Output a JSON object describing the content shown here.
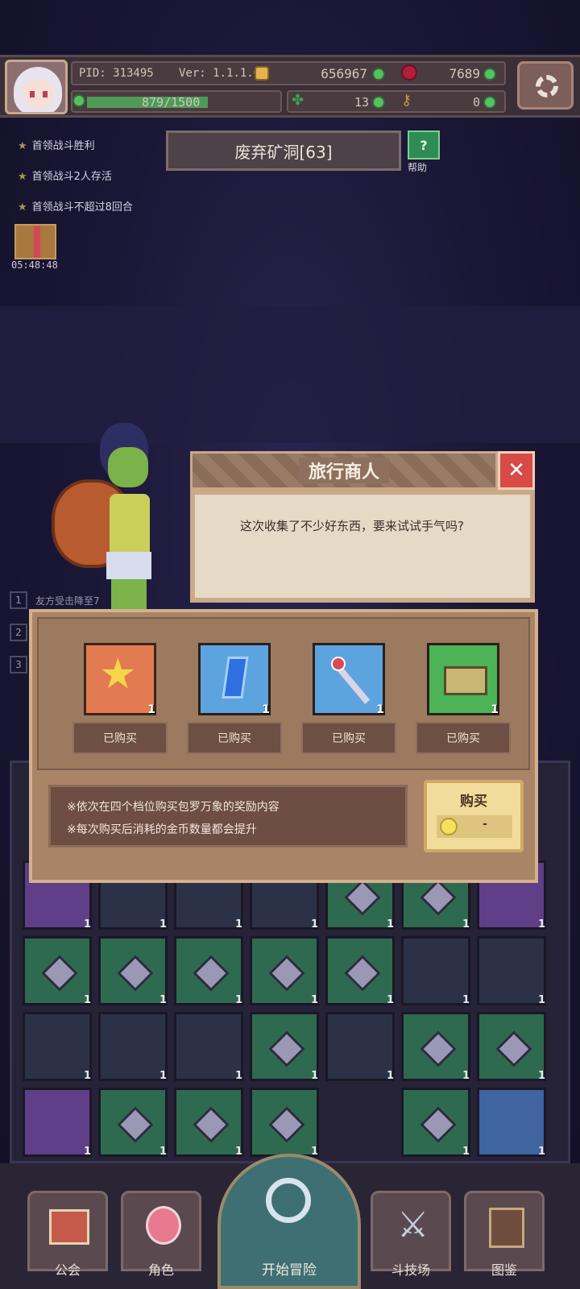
{
  "header": {
    "pid": "PID: 313495",
    "version": "Ver: 1.1.1.0",
    "gold": "656967",
    "red_gems": "7689",
    "exp": "879/1500",
    "clover": "13",
    "keys": "0"
  },
  "quests": [
    "首领战斗胜利",
    "首领战斗2人存活",
    "首领战斗不超过8回合"
  ],
  "timer": "05:48:48",
  "stage": {
    "title": "废弃矿洞[63]",
    "help_label": "帮助"
  },
  "battle_log": [
    "友方受击降至7",
    "",
    ""
  ],
  "dialog": {
    "title": "旅行商人",
    "text": "这次收集了不少好东西，要来试试手气吗?"
  },
  "shop": {
    "items": [
      {
        "icon": "star-icon",
        "qty": "1",
        "status": "已购买"
      },
      {
        "icon": "blue-crystal-icon",
        "qty": "1",
        "status": "已购买"
      },
      {
        "icon": "wand-icon",
        "qty": "1",
        "status": "已购买"
      },
      {
        "icon": "treasure-chest-icon",
        "qty": "1",
        "status": "已购买"
      }
    ],
    "info_line1": "※依次在四个档位购买包罗万象的奖励内容",
    "info_line2": "※每次购买后消耗的金币数量都会提升",
    "buy_label": "购买",
    "buy_price": "-"
  },
  "inventory_count": "1",
  "nav": {
    "guild": "公会",
    "character": "角色",
    "adventure": "开始冒险",
    "arena": "斗技场",
    "codex": "图鉴"
  },
  "colors": {
    "background": "#15122b",
    "dialog_body": "#e6d9c6",
    "shop_panel": "#a98467",
    "buy_button": "#f2dc9c",
    "close_button": "#d74a45"
  }
}
